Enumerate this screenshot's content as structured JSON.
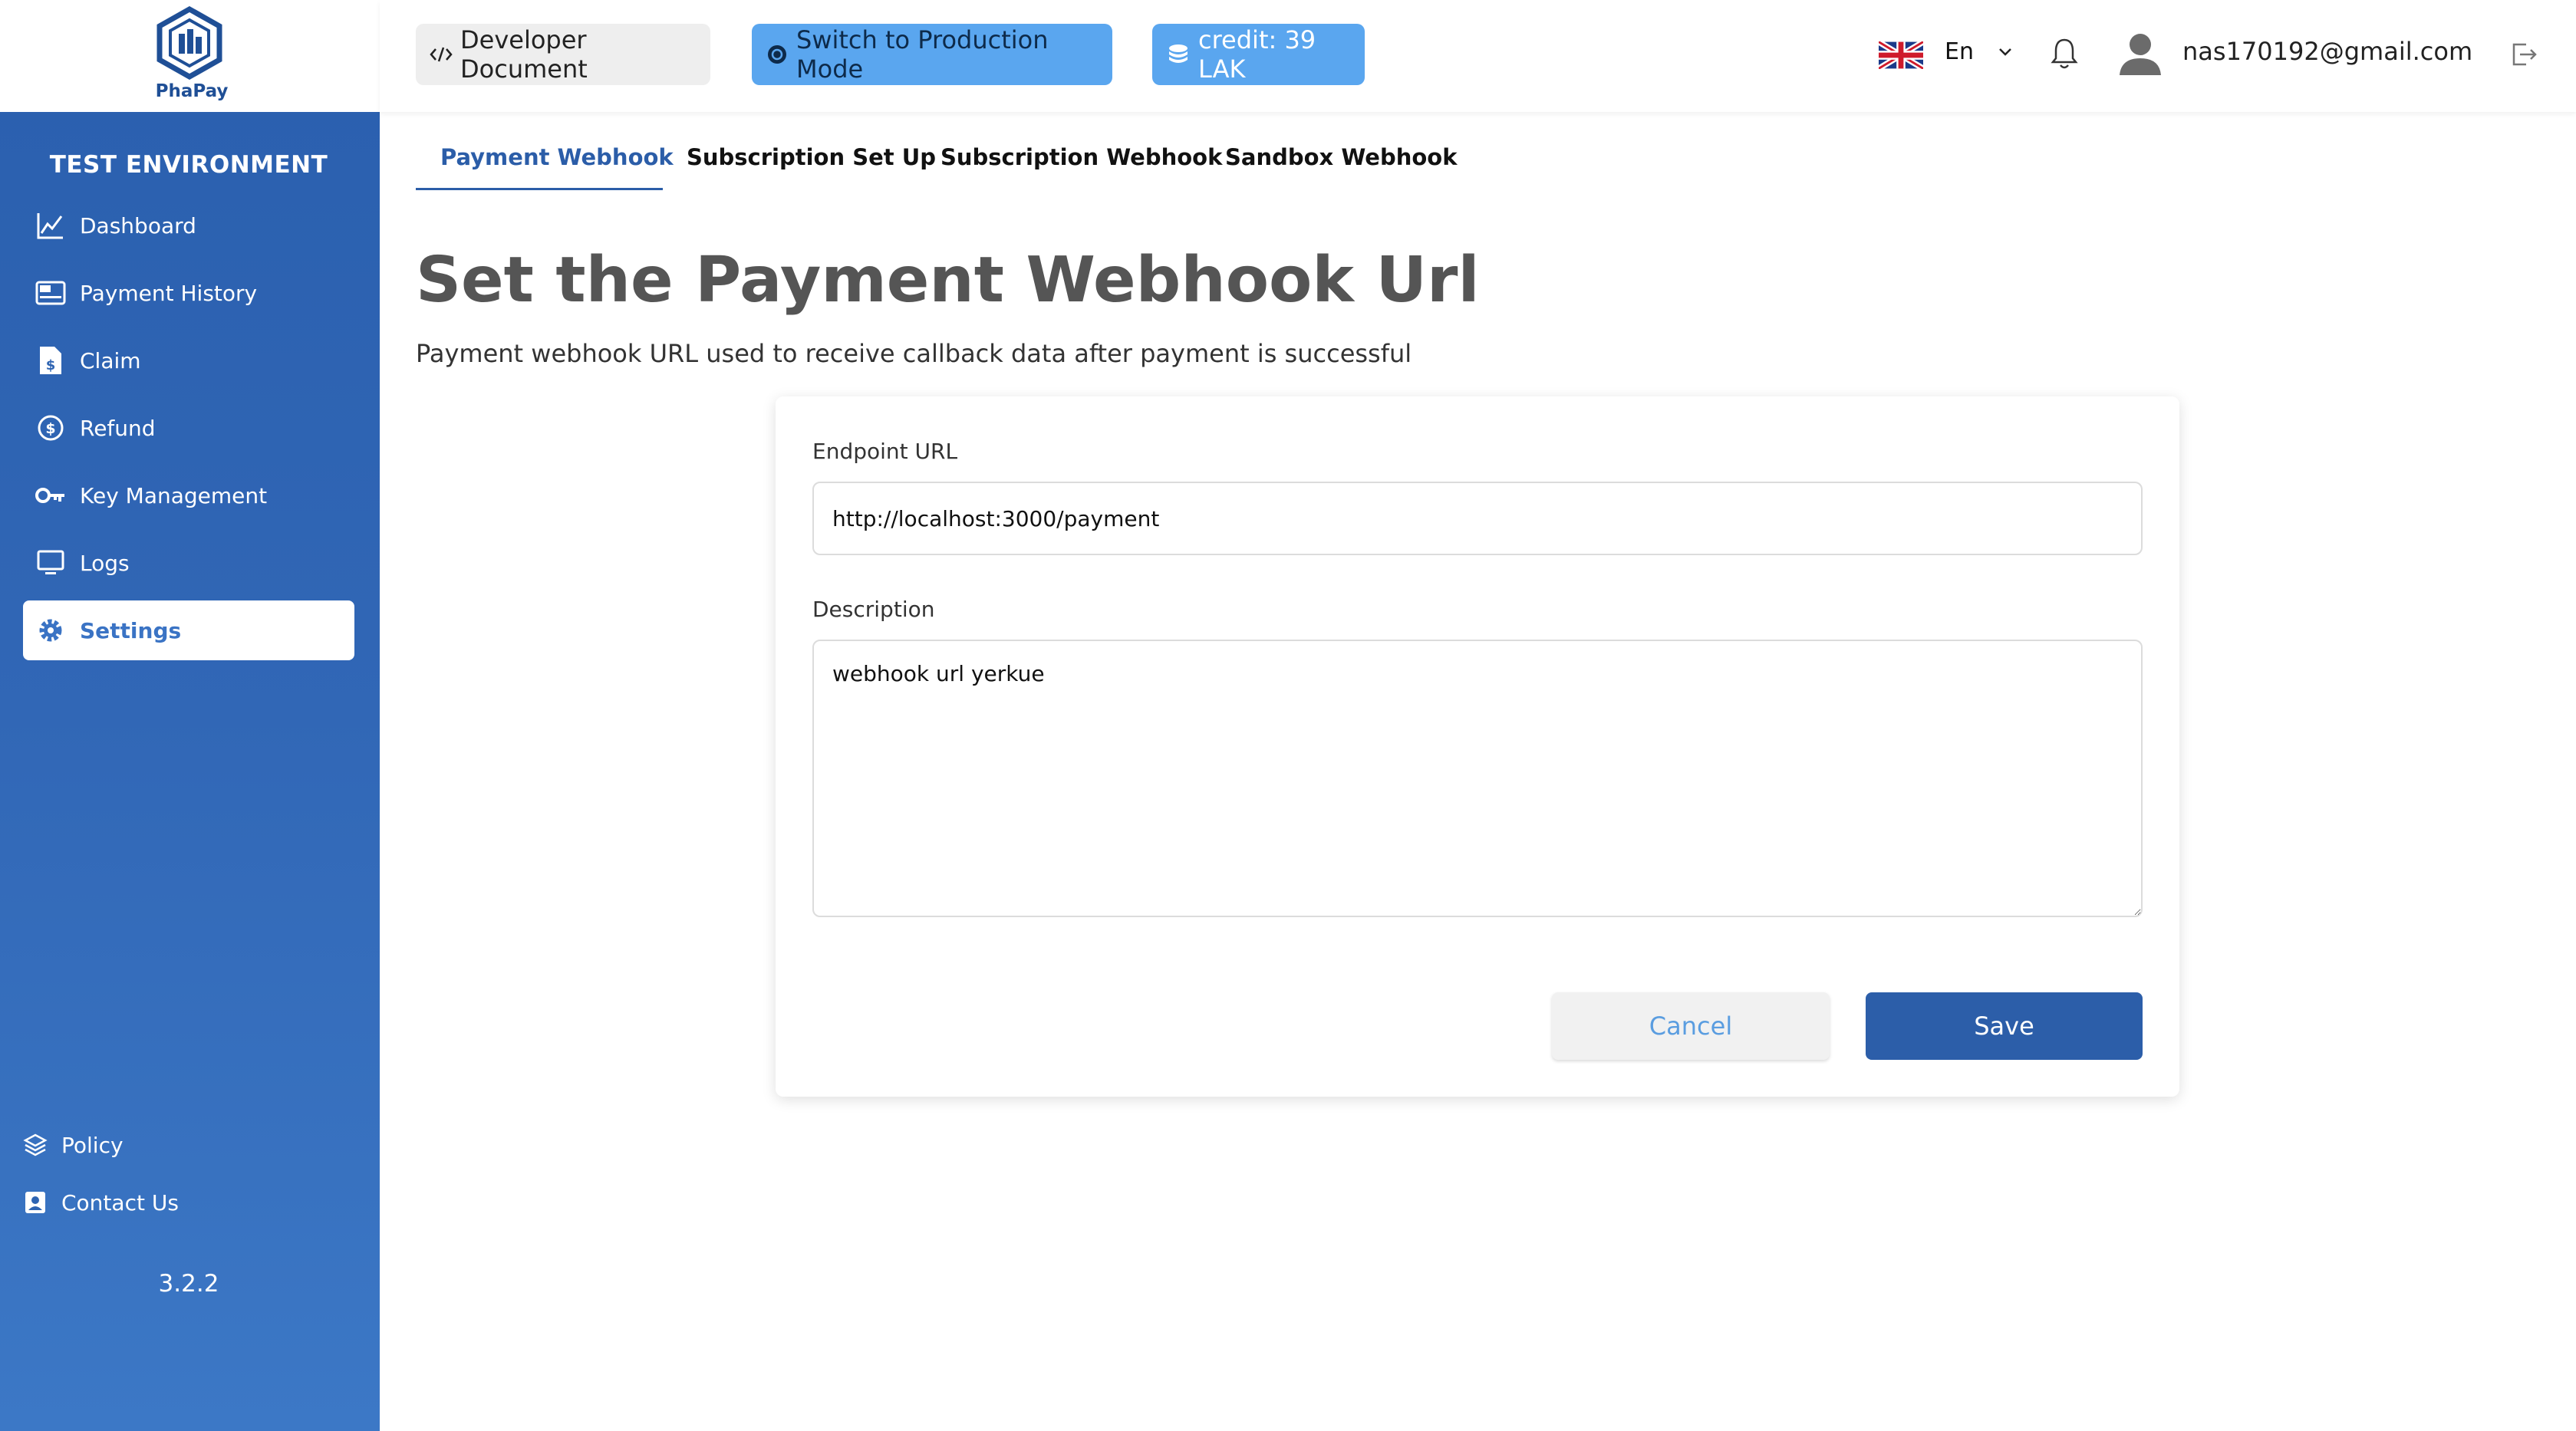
{
  "sidebar": {
    "brand": "PhaPay",
    "environment_title": "TEST ENVIRONMENT",
    "items": [
      {
        "label": "Dashboard",
        "icon": "chart-line-icon"
      },
      {
        "label": "Payment History",
        "icon": "pay-card-icon"
      },
      {
        "label": "Claim",
        "icon": "document-dollar-icon"
      },
      {
        "label": "Refund",
        "icon": "refund-coin-icon"
      },
      {
        "label": "Key Management",
        "icon": "key-icon"
      },
      {
        "label": "Logs",
        "icon": "monitor-icon"
      },
      {
        "label": "Settings",
        "icon": "gear-icon",
        "active": true
      }
    ],
    "footer": [
      {
        "label": "Policy",
        "icon": "layers-icon"
      },
      {
        "label": "Contact Us",
        "icon": "contact-icon"
      }
    ],
    "version": "3.2.2"
  },
  "topbar": {
    "developer_document": "Developer Document",
    "switch_mode": "Switch to Production Mode",
    "credit": "credit: 39 LAK",
    "language": "En",
    "user_email": "nas170192@gmail.com"
  },
  "tabs": [
    {
      "label": "Payment Webhook",
      "active": true
    },
    {
      "label": "Subscription Set Up"
    },
    {
      "label": "Subscription Webhook"
    },
    {
      "label": "Sandbox Webhook"
    }
  ],
  "page": {
    "title": "Set the Payment Webhook Url",
    "subtitle": "Payment webhook URL used to receive callback data after payment is successful"
  },
  "form": {
    "endpoint_label": "Endpoint URL",
    "endpoint_value": "http://localhost:3000/payment",
    "description_label": "Description",
    "description_value": "webhook url yerkue",
    "cancel_label": "Cancel",
    "save_label": "Save"
  },
  "colors": {
    "sidebar": "#2a5fae",
    "accent": "#2c5ea9",
    "light_accent": "#5aa6ef"
  }
}
